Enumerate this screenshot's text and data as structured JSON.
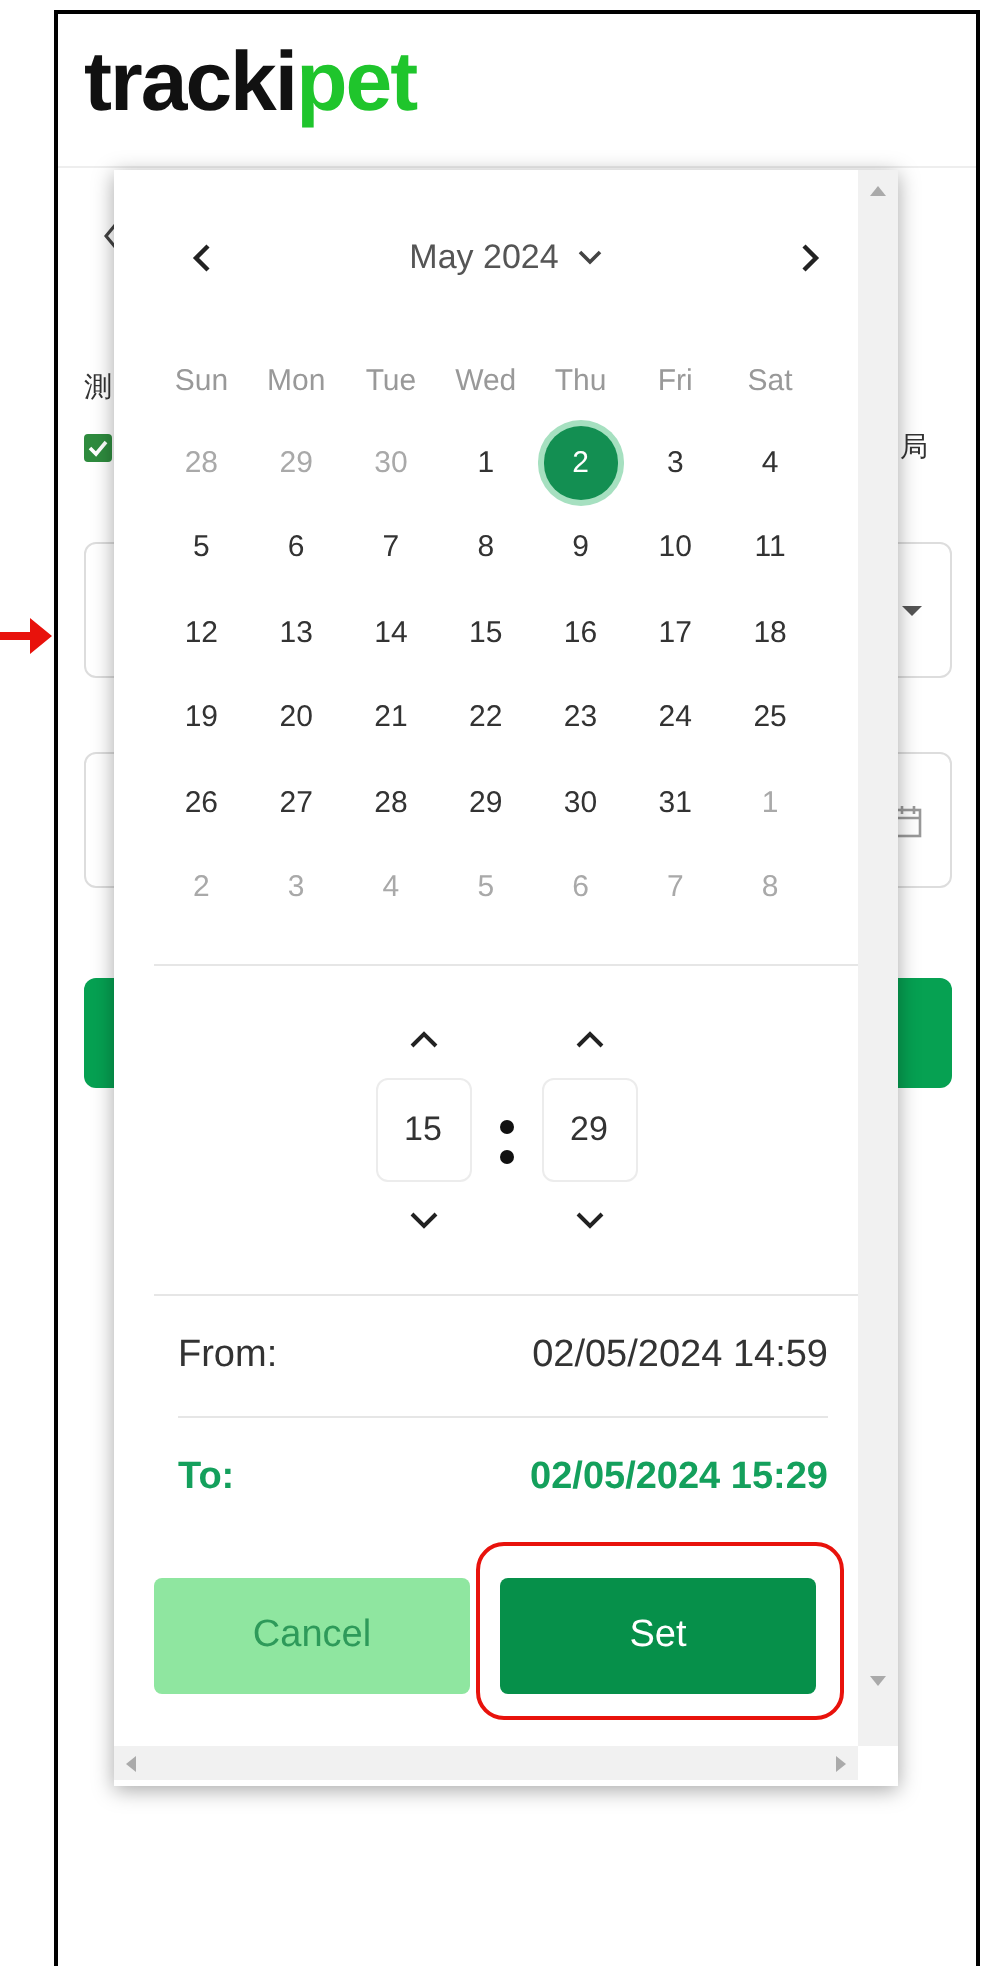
{
  "header": {
    "logo": {
      "dark": "tracki",
      "accent": "pet"
    }
  },
  "form": {
    "label_left": "測",
    "label_right": "局",
    "checkbox": {
      "checked": true
    }
  },
  "date_picker": {
    "month_label": "May 2024",
    "weekdays": [
      "Sun",
      "Mon",
      "Tue",
      "Wed",
      "Thu",
      "Fri",
      "Sat"
    ],
    "days": [
      {
        "label": "28",
        "in_month": false,
        "selected": false
      },
      {
        "label": "29",
        "in_month": false,
        "selected": false
      },
      {
        "label": "30",
        "in_month": false,
        "selected": false
      },
      {
        "label": "1",
        "in_month": true,
        "selected": false
      },
      {
        "label": "2",
        "in_month": true,
        "selected": true
      },
      {
        "label": "3",
        "in_month": true,
        "selected": false
      },
      {
        "label": "4",
        "in_month": true,
        "selected": false
      },
      {
        "label": "5",
        "in_month": true,
        "selected": false
      },
      {
        "label": "6",
        "in_month": true,
        "selected": false
      },
      {
        "label": "7",
        "in_month": true,
        "selected": false
      },
      {
        "label": "8",
        "in_month": true,
        "selected": false
      },
      {
        "label": "9",
        "in_month": true,
        "selected": false
      },
      {
        "label": "10",
        "in_month": true,
        "selected": false
      },
      {
        "label": "11",
        "in_month": true,
        "selected": false
      },
      {
        "label": "12",
        "in_month": true,
        "selected": false
      },
      {
        "label": "13",
        "in_month": true,
        "selected": false
      },
      {
        "label": "14",
        "in_month": true,
        "selected": false
      },
      {
        "label": "15",
        "in_month": true,
        "selected": false
      },
      {
        "label": "16",
        "in_month": true,
        "selected": false
      },
      {
        "label": "17",
        "in_month": true,
        "selected": false
      },
      {
        "label": "18",
        "in_month": true,
        "selected": false
      },
      {
        "label": "19",
        "in_month": true,
        "selected": false
      },
      {
        "label": "20",
        "in_month": true,
        "selected": false
      },
      {
        "label": "21",
        "in_month": true,
        "selected": false
      },
      {
        "label": "22",
        "in_month": true,
        "selected": false
      },
      {
        "label": "23",
        "in_month": true,
        "selected": false
      },
      {
        "label": "24",
        "in_month": true,
        "selected": false
      },
      {
        "label": "25",
        "in_month": true,
        "selected": false
      },
      {
        "label": "26",
        "in_month": true,
        "selected": false
      },
      {
        "label": "27",
        "in_month": true,
        "selected": false
      },
      {
        "label": "28",
        "in_month": true,
        "selected": false
      },
      {
        "label": "29",
        "in_month": true,
        "selected": false
      },
      {
        "label": "30",
        "in_month": true,
        "selected": false
      },
      {
        "label": "31",
        "in_month": true,
        "selected": false
      },
      {
        "label": "1",
        "in_month": false,
        "selected": false
      },
      {
        "label": "2",
        "in_month": false,
        "selected": false
      },
      {
        "label": "3",
        "in_month": false,
        "selected": false
      },
      {
        "label": "4",
        "in_month": false,
        "selected": false
      },
      {
        "label": "5",
        "in_month": false,
        "selected": false
      },
      {
        "label": "6",
        "in_month": false,
        "selected": false
      },
      {
        "label": "7",
        "in_month": false,
        "selected": false
      },
      {
        "label": "8",
        "in_month": false,
        "selected": false
      }
    ],
    "time": {
      "hour": "15",
      "minute": "29"
    },
    "range": [
      {
        "label": "From:",
        "value": "02/05/2024 14:59",
        "active": false
      },
      {
        "label": "To:",
        "value": "02/05/2024 15:29",
        "active": true
      }
    ],
    "buttons": [
      {
        "label": "Cancel",
        "kind": "secondary",
        "highlighted": false
      },
      {
        "label": "Set",
        "kind": "primary",
        "highlighted": true
      }
    ]
  }
}
